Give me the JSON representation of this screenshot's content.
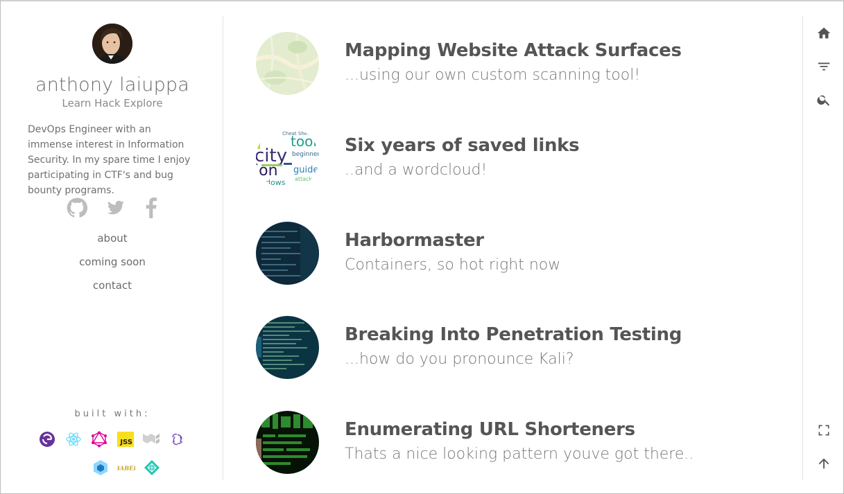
{
  "profile": {
    "name": "anthony laiuppa",
    "tagline": "Learn Hack Explore",
    "bio": "DevOps Engineer with an immense interest in Information Security. In my spare time I enjoy participating in CTF's and bug bounty programs."
  },
  "social": [
    {
      "icon": "github-icon"
    },
    {
      "icon": "twitter-icon"
    },
    {
      "icon": "facebook-icon"
    }
  ],
  "nav": [
    {
      "label": "about"
    },
    {
      "label": "coming soon"
    },
    {
      "label": "contact"
    }
  ],
  "built_with": {
    "label": "built with:",
    "tools": [
      "gatsby-icon",
      "react-icon",
      "graphql-icon",
      "jss-icon",
      "material-ui-icon",
      "redux-icon",
      "webpack-icon",
      "babel-icon",
      "netlify-icon"
    ],
    "jss_text": "JSS",
    "babel_text": "BABEL"
  },
  "posts": [
    {
      "title": "Mapping Website Attack Surfaces",
      "subtitle": "...using our own custom scanning tool!"
    },
    {
      "title": "Six years of saved links",
      "subtitle": "..and a wordcloud!"
    },
    {
      "title": "Harbormaster",
      "subtitle": "Containers, so hot right now"
    },
    {
      "title": "Breaking Into Penetration Testing",
      "subtitle": "...how do you pronounce Kali?"
    },
    {
      "title": "Enumerating URL Shorteners",
      "subtitle": "Thats a nice looking pattern youve got there.."
    }
  ],
  "wordcloud_words": [
    "Cheat Sheet",
    "tool",
    "city",
    "beginner",
    "guide",
    "ion",
    "attack",
    "dows"
  ],
  "rail": [
    "home-icon",
    "filter-icon",
    "search-icon",
    "fullscreen-icon",
    "arrow-up-icon"
  ],
  "colors": {
    "text_primary": "#555555",
    "text_secondary": "#777777",
    "divider": "#e0e0e0",
    "icon": "#bdbdbd",
    "rail_icon": "#555555"
  }
}
